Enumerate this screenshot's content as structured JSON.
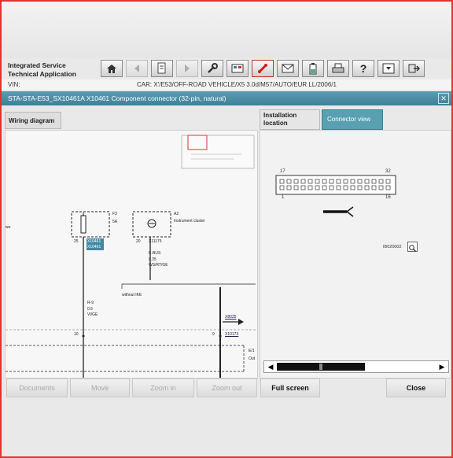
{
  "app": {
    "title_line1": "Integrated Service",
    "title_line2": "Technical Application"
  },
  "toolbar": {
    "icons": [
      "home-icon",
      "back-icon",
      "document-icon",
      "forward-icon",
      "wrench-icon",
      "diagnosis-icon",
      "connection-icon",
      "mail-icon",
      "battery-icon",
      "printer-icon",
      "help-icon",
      "download-icon",
      "exit-icon"
    ]
  },
  "vehicle": {
    "vin_label": "VIN:",
    "car_label": "CAR:",
    "car_value": "X'/E53/OFF-ROAD VEHICLE/X5 3.0d/M57/AUTO/EUR LL/2006/1"
  },
  "window": {
    "title": "STA-STA-E53_SX10461A X10461 Component connector (32-pin, natural)",
    "close": "✕"
  },
  "tabs": {
    "wiring": "Wiring diagram",
    "installation_line1": "Installation",
    "installation_line2": "location",
    "connector": "Connector view"
  },
  "diagram": {
    "left_edge": "wu",
    "fuse_id": "F3",
    "fuse_rating": "5A",
    "fuse_pin": "25",
    "fuse_conn_a": "X10461",
    "fuse_conn_b": "X10461",
    "cluster_id": "A2",
    "cluster_label": "Instrument cluster",
    "cluster_pin": "20",
    "cluster_conn": "X11175",
    "kbus_line1": "K-BUS",
    "kbus_line2": "0.35",
    "kbus_line3": "WS/RT/GE",
    "without_ike": "without IKE",
    "wire_line1": "R-9",
    "wire_line2": "0.5",
    "wire_line3": "VI/GE",
    "node_left": "10",
    "node_right": "9",
    "arrow_ref": "X8035",
    "right_conn": "X10173",
    "right_edge_1": "E/1",
    "right_edge_2": "Out"
  },
  "connector": {
    "pin_tl": "17",
    "pin_tr": "32",
    "pin_bl": "1",
    "pin_br": "16",
    "image_id": "IB020002"
  },
  "buttons": {
    "documents": "Documents",
    "move": "Move",
    "zoom_in": "Zoom in",
    "zoom_out": "Zoom out",
    "full_screen": "Full screen",
    "close": "Close"
  },
  "colors": {
    "accent": "#4a8ea4",
    "frame": "#e0342e"
  }
}
